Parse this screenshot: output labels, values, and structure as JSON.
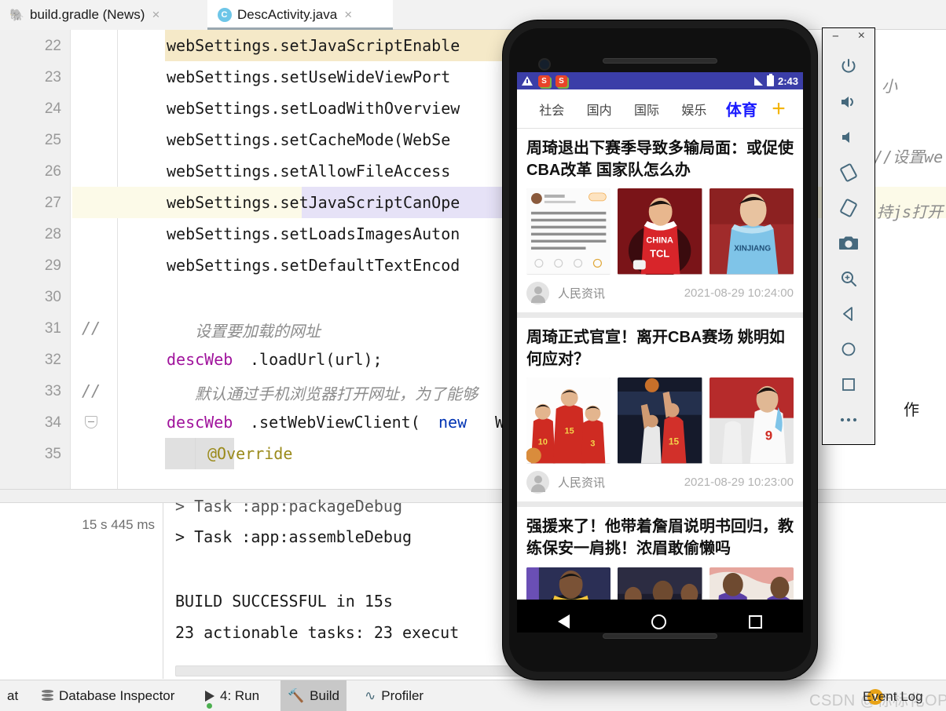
{
  "ide": {
    "tabs": [
      {
        "label": "build.gradle (News)",
        "icon": "gradle-elephant-icon",
        "close": "×",
        "active": false
      },
      {
        "label": "DescActivity.java",
        "icon": "java-class-icon",
        "close": "×",
        "active": true
      }
    ],
    "editor": {
      "lines": [
        {
          "num": "22",
          "text": "webSettings.setJavaScriptEnable"
        },
        {
          "num": "23",
          "text": "webSettings.setUseWideViewPort"
        },
        {
          "num": "24",
          "text": "webSettings.setLoadWithOverview"
        },
        {
          "num": "25",
          "text": "webSettings.setCacheMode(WebSe"
        },
        {
          "num": "26",
          "text": "webSettings.setAllowFileAccess"
        },
        {
          "num": "27",
          "text": "webSettings.setJavaScriptCanOpe"
        },
        {
          "num": "28",
          "text": "webSettings.setLoadsImagesAuton"
        },
        {
          "num": "29",
          "text": "webSettings.setDefaultTextEncod"
        },
        {
          "num": "30",
          "text": ""
        },
        {
          "num": "31",
          "text": ""
        },
        {
          "num": "32",
          "text": ""
        },
        {
          "num": "33",
          "text": ""
        },
        {
          "num": "34",
          "text": ""
        },
        {
          "num": "35",
          "text": ""
        }
      ],
      "line31_comment_marker": "//",
      "line31_comment": "设置要加载的网址",
      "line32_obj": "descWeb",
      "line32_rest": ".loadUrl(url);",
      "line33_comment_marker": "//",
      "line33_comment": "默认通过手机浏览器打开网址，为了能够",
      "line34_obj": "descWeb",
      "line34_mid": ".setWebViewClient(",
      "line34_kw": "new",
      "line34_tail": " We",
      "line35_annotation": "@Override",
      "right_fragments": [
        "小",
        "//设置we",
        "持js打开",
        "作"
      ]
    },
    "build": {
      "duration": "15 s 445 ms",
      "console": [
        "> Task :app:packageDebug",
        "> Task :app:assembleDebug",
        "",
        "BUILD SUCCESSFUL in 15s",
        "23 actionable tasks: 23 execut"
      ]
    },
    "statusbar": {
      "items": [
        {
          "label": "at",
          "icon": "",
          "active": false
        },
        {
          "label": "Database Inspector",
          "icon": "database-icon",
          "active": false
        },
        {
          "label": "4: Run",
          "icon": "run-icon",
          "active": false
        },
        {
          "label": "Build",
          "icon": "hammer-icon",
          "active": true
        },
        {
          "label": "Profiler",
          "icon": "profiler-icon",
          "active": false
        }
      ],
      "event_log": "Event Log",
      "event_count": "1",
      "watermark": "CSDN @标标化OPPO"
    }
  },
  "emulator": {
    "toolbar": {
      "minimize": "−",
      "close": "×",
      "buttons": [
        "power-icon",
        "volume-up-icon",
        "volume-down-icon",
        "rotate-left-icon",
        "rotate-right-icon",
        "camera-icon",
        "zoom-icon",
        "back-icon",
        "home-icon",
        "overview-icon",
        "more-icon"
      ]
    },
    "android": {
      "statusbar": {
        "clock": "2:43",
        "icons": [
          "warning-icon",
          "sogou-icon",
          "sogou-icon-2",
          "signal-icon",
          "battery-icon"
        ]
      },
      "app": {
        "tabs": [
          {
            "label": "社会",
            "selected": false
          },
          {
            "label": "国内",
            "selected": false
          },
          {
            "label": "国际",
            "selected": false
          },
          {
            "label": "娱乐",
            "selected": false
          },
          {
            "label": "体育",
            "selected": true
          }
        ],
        "add_label": "+",
        "news": [
          {
            "title": "周琦退出下赛季导致多输局面：或促使CBA改革 国家队怎么办",
            "source": "人民资讯",
            "date": "2021-08-29 10:24:00",
            "images": [
              "weibo-screenshot",
              "china-tcl-jersey",
              "xinjiang-jersey"
            ]
          },
          {
            "title": "周琦正式官宣！离开CBA赛场 姚明如何应对？",
            "source": "人民资讯",
            "date": "2021-08-29 10:23:00",
            "images": [
              "three-players-red",
              "layup-action",
              "player-9-white"
            ]
          },
          {
            "title": "强援来了！他带着詹眉说明书回归，教练保安一肩挑！浓眉敢偷懒吗",
            "source": "",
            "date": "",
            "images": [
              "lakers-black-jersey",
              "lakers-rondo",
              "lakers-handshake"
            ]
          }
        ]
      },
      "navbar": [
        "back-icon",
        "home-icon",
        "recents-icon"
      ]
    }
  },
  "colors": {
    "accent_blue": "#1a1aff",
    "status_blue": "#3b3ea8",
    "plus_yellow": "#f4b400",
    "highlight_yellow": "#f5e9c8",
    "selection_purple": "#e6e2f7"
  }
}
